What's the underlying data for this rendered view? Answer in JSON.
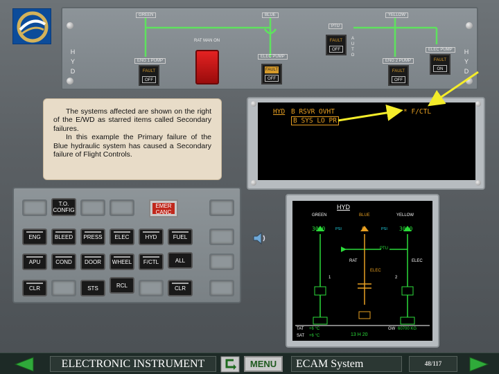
{
  "hyd_panel": {
    "side_letters": [
      "H",
      "Y",
      "D"
    ],
    "green_label": "GREEN",
    "blue_label": "BLUE",
    "yellow_label": "YELLOW",
    "ptu_label": "PTU",
    "rat_label": "RAT MAN ON",
    "elec_pump_label": "ELEC PUMP",
    "eng1_pump_label": "ENG 1 PUMP",
    "eng2_pump_label": "ENG 2 PUMP",
    "elec_pump_y_label": "ELEC PUMP",
    "auto_label": "A U T O",
    "fault": "FAULT",
    "off": "OFF",
    "on": "ON"
  },
  "note": {
    "para1": "The systems affected are shown on the right of the E/WD as starred items called Secondary failures.",
    "para2": "In this example the Primary failure of the Blue hydraulic system has caused a Secondary failure of Flight Controls."
  },
  "ewd": {
    "hyd": "HYD",
    "line1": "B RSVR OVHT",
    "line2": "B SYS LO PR",
    "secondary": "* F/CTL"
  },
  "ecp": {
    "to_config": "T.O. CONFIG",
    "emer_canc": "EMER CANC",
    "row1": [
      "ENG",
      "BLEED",
      "PRESS",
      "ELEC",
      "HYD",
      "FUEL"
    ],
    "row2": [
      "APU",
      "COND",
      "DOOR",
      "WHEEL",
      "F/CTL",
      "ALL"
    ],
    "clr_left": "CLR",
    "sts": "STS",
    "rcl": "RCL",
    "clr_right": "CLR"
  },
  "sd": {
    "title": "HYD",
    "green": "GREEN",
    "blue": "BLUE",
    "yellow": "YELLOW",
    "green_psi": "3000",
    "blue_psi": "0",
    "yellow_psi": "3000",
    "psi": "PSI",
    "ptu": "PTU",
    "rat": "RAT",
    "elec": "ELEC",
    "elec_y": "ELEC",
    "eng1": "1",
    "eng2": "2",
    "tat_label": "TAT",
    "sat_label": "SAT",
    "tat": "+6 °C",
    "sat": "+6 °C",
    "gw": "GW",
    "gw_value": "60700 KG",
    "time": "13 H 20"
  },
  "nav": {
    "course": "ELECTRONIC INSTRUMENT",
    "menu": "MENU",
    "chapter": "ECAM System",
    "page": "48/117"
  },
  "colors": {
    "green": "#2bdc3a",
    "amber": "#e8a022",
    "cyan": "#22d6e8",
    "white": "#ffffff"
  }
}
